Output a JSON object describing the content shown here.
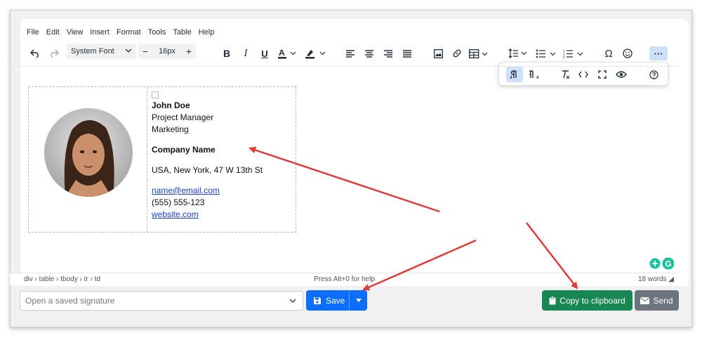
{
  "menubar": [
    "File",
    "Edit",
    "View",
    "Insert",
    "Format",
    "Tools",
    "Table",
    "Help"
  ],
  "toolbar": {
    "font_family": "System Font",
    "font_size": "16px"
  },
  "signature": {
    "name": "John Doe",
    "title": "Project Manager",
    "department": "Marketing",
    "company": "Company Name",
    "address": "USA, New York, 47 W 13th St",
    "email": "name@email.com",
    "phone": "(555) 555-123",
    "website": "website.com"
  },
  "statusbar": {
    "path": "div › table › tbody › tr › td",
    "help": "Press Alt+0 for help",
    "words": "18 words"
  },
  "bottom": {
    "select_placeholder": "Open a saved signature",
    "save_label": "Save",
    "copy_label": "Copy to clipboard",
    "send_label": "Send"
  },
  "colors": {
    "save": "#0d6efd",
    "copy": "#198754",
    "send": "#6c757d",
    "arrow": "#e03a3a"
  }
}
